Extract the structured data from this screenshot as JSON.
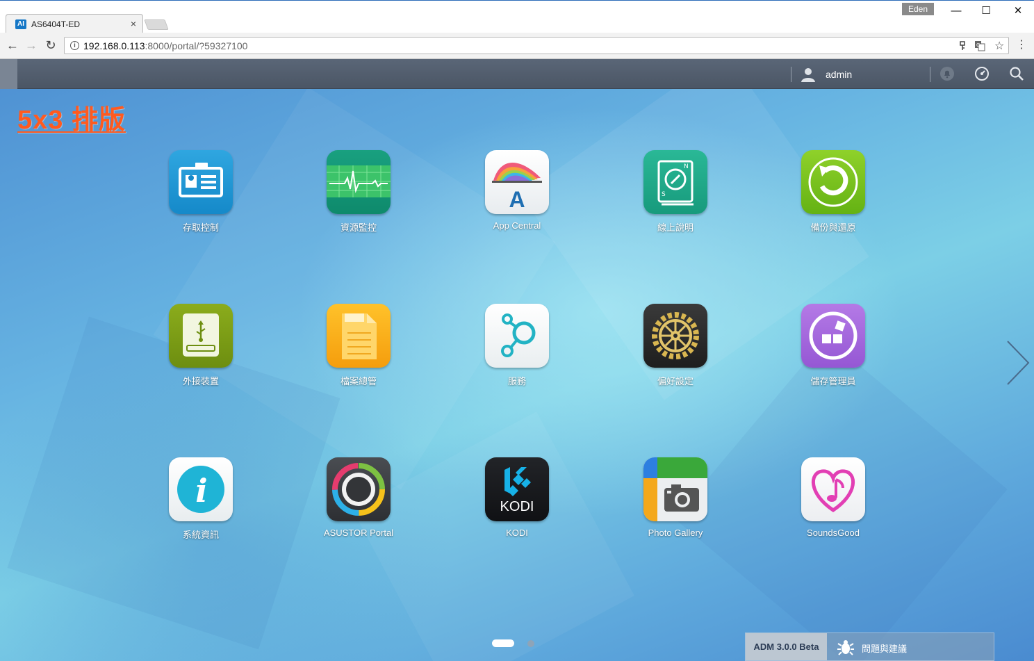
{
  "browser": {
    "tab_title": "AS6404T-ED",
    "tab_favicon": "AI",
    "tab_close": "×",
    "profile_name": "Eden",
    "url_host": "192.168.0.113",
    "url_rest": ":8000/portal/?59327100",
    "window_controls": {
      "minimize": "—",
      "maximize": "☐",
      "close": "✕"
    },
    "nav": {
      "back": "←",
      "forward": "→",
      "reload": "↻"
    }
  },
  "adm": {
    "user_name": "admin",
    "overlay_title": "5x3 排版",
    "version": "ADM 3.0.0 Beta",
    "feedback": "問題與建議",
    "pages": 2,
    "current_page": 1,
    "apps": [
      {
        "label": "存取控制",
        "icon": "access-control-icon"
      },
      {
        "label": "資源監控",
        "icon": "resource-monitor-icon"
      },
      {
        "label": "App Central",
        "icon": "app-central-icon"
      },
      {
        "label": "線上說明",
        "icon": "online-help-icon"
      },
      {
        "label": "備份與還原",
        "icon": "backup-restore-icon"
      },
      {
        "label": "外接裝置",
        "icon": "external-devices-icon"
      },
      {
        "label": "檔案總管",
        "icon": "file-explorer-icon"
      },
      {
        "label": "服務",
        "icon": "services-icon"
      },
      {
        "label": "偏好設定",
        "icon": "preferences-icon"
      },
      {
        "label": "儲存管理員",
        "icon": "storage-manager-icon"
      },
      {
        "label": "系統資訊",
        "icon": "system-info-icon"
      },
      {
        "label": "ASUSTOR Portal",
        "icon": "asustor-portal-icon"
      },
      {
        "label": "KODI",
        "icon": "kodi-icon",
        "icon_text": "KODI"
      },
      {
        "label": "Photo Gallery",
        "icon": "photo-gallery-icon"
      },
      {
        "label": "SoundsGood",
        "icon": "soundsgood-icon"
      }
    ]
  },
  "colors": {
    "overlay": "#ff5a1f",
    "topbar": "#525e6e",
    "version_bg": "#bcc7d2"
  }
}
